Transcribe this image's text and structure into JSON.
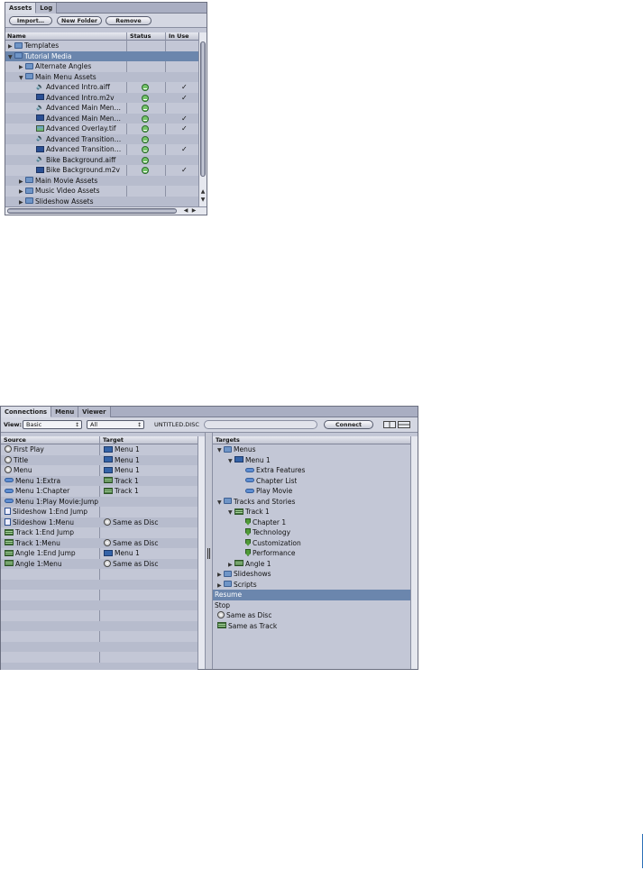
{
  "assets": {
    "tabs": [
      {
        "label": "Assets"
      },
      {
        "label": "Log"
      }
    ],
    "buttons": {
      "import": "Import…",
      "new_folder": "New Folder",
      "remove": "Remove"
    },
    "columns": {
      "name": "Name",
      "status": "Status",
      "in_use": "In Use"
    },
    "rows": [
      {
        "label": "Templates",
        "icon": "folder-icon",
        "indent": 0,
        "expander": "closed",
        "status": false,
        "in_use": false,
        "selected": false
      },
      {
        "label": "Tutorial Media",
        "icon": "folder-icon",
        "indent": 0,
        "expander": "open",
        "status": false,
        "in_use": false,
        "selected": true
      },
      {
        "label": "Alternate Angles",
        "icon": "folder-icon",
        "indent": 1,
        "expander": "closed",
        "status": false,
        "in_use": false,
        "selected": false
      },
      {
        "label": "Main Menu Assets",
        "icon": "folder-icon",
        "indent": 1,
        "expander": "open",
        "status": false,
        "in_use": false,
        "selected": false
      },
      {
        "label": "Advanced Intro.aiff",
        "icon": "speaker-icon",
        "indent": 2,
        "expander": "",
        "status": true,
        "in_use": true,
        "selected": false
      },
      {
        "label": "Advanced Intro.m2v",
        "icon": "film-icon",
        "indent": 2,
        "expander": "",
        "status": true,
        "in_use": true,
        "selected": false
      },
      {
        "label": "Advanced Main Men…",
        "icon": "speaker-icon",
        "indent": 2,
        "expander": "",
        "status": true,
        "in_use": false,
        "selected": false
      },
      {
        "label": "Advanced Main Men…",
        "icon": "film-icon",
        "indent": 2,
        "expander": "",
        "status": true,
        "in_use": true,
        "selected": false
      },
      {
        "label": "Advanced Overlay.tif",
        "icon": "image-icon",
        "indent": 2,
        "expander": "",
        "status": true,
        "in_use": true,
        "selected": false
      },
      {
        "label": "Advanced Transition…",
        "icon": "speaker-icon",
        "indent": 2,
        "expander": "",
        "status": true,
        "in_use": false,
        "selected": false
      },
      {
        "label": "Advanced Transition…",
        "icon": "film-icon",
        "indent": 2,
        "expander": "",
        "status": true,
        "in_use": true,
        "selected": false
      },
      {
        "label": "Bike Background.aiff",
        "icon": "speaker-icon",
        "indent": 2,
        "expander": "",
        "status": true,
        "in_use": false,
        "selected": false
      },
      {
        "label": "Bike Background.m2v",
        "icon": "film-icon",
        "indent": 2,
        "expander": "",
        "status": true,
        "in_use": true,
        "selected": false
      },
      {
        "label": "Main Movie Assets",
        "icon": "folder-icon",
        "indent": 1,
        "expander": "closed",
        "status": false,
        "in_use": false,
        "selected": false
      },
      {
        "label": "Music Video Assets",
        "icon": "folder-icon",
        "indent": 1,
        "expander": "closed",
        "status": false,
        "in_use": false,
        "selected": false
      },
      {
        "label": "Slideshow Assets",
        "icon": "folder-icon",
        "indent": 1,
        "expander": "closed",
        "status": false,
        "in_use": false,
        "selected": false
      }
    ],
    "check_glyph": "✓"
  },
  "connections": {
    "tabs": [
      {
        "label": "Connections"
      },
      {
        "label": "Menu"
      },
      {
        "label": "Viewer"
      }
    ],
    "view_label": "View:",
    "view_value": "Basic",
    "filter_value": "All",
    "disc_name": "UNTITLED.DISC",
    "connect_label": "Connect",
    "source_header": "Source",
    "target_header": "Target",
    "targets_header": "Targets",
    "rows": [
      {
        "source": "First Play",
        "source_icon": "disc-icon",
        "target": "Menu 1",
        "target_icon": "menu-icon"
      },
      {
        "source": "Title",
        "source_icon": "disc-icon",
        "target": "Menu 1",
        "target_icon": "menu-icon"
      },
      {
        "source": "Menu",
        "source_icon": "disc-icon",
        "target": "Menu 1",
        "target_icon": "menu-icon"
      },
      {
        "source": "Menu 1:Extra",
        "source_icon": "button-icon",
        "target": "Track 1",
        "target_icon": "track-icon"
      },
      {
        "source": "Menu 1:Chapter",
        "source_icon": "button-icon",
        "target": "Track 1",
        "target_icon": "track-icon"
      },
      {
        "source": "Menu 1:Play Movie:Jump",
        "source_icon": "button-icon",
        "target": "",
        "target_icon": ""
      },
      {
        "source": "Slideshow 1:End Jump",
        "source_icon": "slideshow-icon",
        "target": "",
        "target_icon": ""
      },
      {
        "source": "Slideshow 1:Menu",
        "source_icon": "slideshow-icon",
        "target": "Same as Disc",
        "target_icon": "disc-icon"
      },
      {
        "source": "Track 1:End Jump",
        "source_icon": "track-icon",
        "target": "",
        "target_icon": ""
      },
      {
        "source": "Track 1:Menu",
        "source_icon": "track-icon",
        "target": "Same as Disc",
        "target_icon": "disc-icon"
      },
      {
        "source": "Angle 1:End Jump",
        "source_icon": "track-icon",
        "target": "Menu 1",
        "target_icon": "menu-icon"
      },
      {
        "source": "Angle 1:Menu",
        "source_icon": "track-icon",
        "target": "Same as Disc",
        "target_icon": "disc-icon"
      }
    ],
    "tree": [
      {
        "label": "Menus",
        "icon": "folder-icon",
        "indent": 0,
        "expander": "open",
        "selected": false
      },
      {
        "label": "Menu 1",
        "icon": "menu-icon",
        "indent": 1,
        "expander": "open",
        "selected": false
      },
      {
        "label": "Extra Features",
        "icon": "button-icon",
        "indent": 2,
        "expander": "",
        "selected": false
      },
      {
        "label": "Chapter List",
        "icon": "button-icon",
        "indent": 2,
        "expander": "",
        "selected": false
      },
      {
        "label": "Play Movie",
        "icon": "button-icon",
        "indent": 2,
        "expander": "",
        "selected": false
      },
      {
        "label": "Tracks and Stories",
        "icon": "folder-icon",
        "indent": 0,
        "expander": "open",
        "selected": false
      },
      {
        "label": "Track 1",
        "icon": "track-icon",
        "indent": 1,
        "expander": "open",
        "selected": false
      },
      {
        "label": "Chapter 1",
        "icon": "marker-icon",
        "indent": 2,
        "expander": "",
        "selected": false
      },
      {
        "label": "Technology",
        "icon": "marker-icon",
        "indent": 2,
        "expander": "",
        "selected": false
      },
      {
        "label": "Customization",
        "icon": "marker-icon",
        "indent": 2,
        "expander": "",
        "selected": false
      },
      {
        "label": "Performance",
        "icon": "marker-icon",
        "indent": 2,
        "expander": "",
        "selected": false
      },
      {
        "label": "Angle 1",
        "icon": "track-icon",
        "indent": 1,
        "expander": "closed",
        "selected": false
      },
      {
        "label": "Slideshows",
        "icon": "folder-icon",
        "indent": 0,
        "expander": "closed",
        "selected": false
      },
      {
        "label": "Scripts",
        "icon": "folder-icon",
        "indent": 0,
        "expander": "closed",
        "selected": false
      },
      {
        "label": "Resume",
        "icon": "",
        "indent": 0,
        "expander": "",
        "selected": true
      },
      {
        "label": "Stop",
        "icon": "",
        "indent": 0,
        "expander": "",
        "selected": false
      },
      {
        "label": "Same as Disc",
        "icon": "disc-icon",
        "indent": 0,
        "expander": "",
        "selected": false
      },
      {
        "label": "Same as Track",
        "icon": "track-icon",
        "indent": 0,
        "expander": "",
        "selected": false
      }
    ]
  },
  "page": {
    "footer_rule": "|"
  },
  "colors": {
    "panel": "#c3c7d6",
    "selection": "#6b86ad",
    "accent": "#3463a8"
  }
}
